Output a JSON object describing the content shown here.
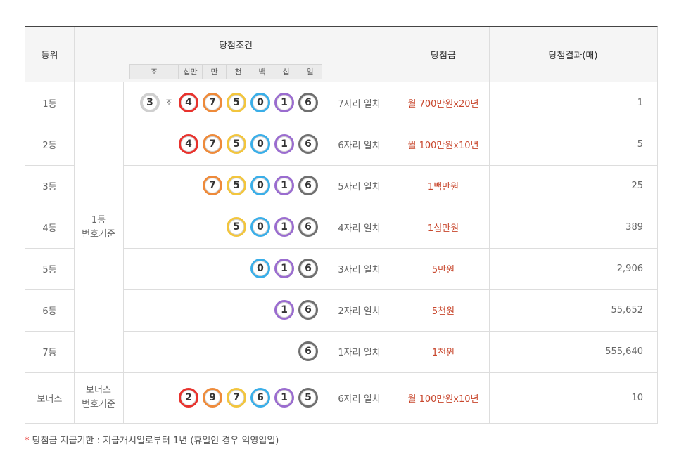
{
  "header": {
    "rank": "등위",
    "condition": "당첨조건",
    "prize": "당첨금",
    "result": "당첨결과(매)",
    "digits": [
      "조",
      "십만",
      "만",
      "천",
      "백",
      "십",
      "일"
    ]
  },
  "criteria": {
    "main": "1등\n번호기준",
    "bonus": "보너스\n번호기준"
  },
  "rows": [
    {
      "rank": "1등",
      "match": "7자리 일치",
      "prize": "월 700만원x20년",
      "count": "1"
    },
    {
      "rank": "2등",
      "match": "6자리 일치",
      "prize": "월 100만원x10년",
      "count": "5"
    },
    {
      "rank": "3등",
      "match": "5자리 일치",
      "prize": "1백만원",
      "count": "25"
    },
    {
      "rank": "4등",
      "match": "4자리 일치",
      "prize": "1십만원",
      "count": "389"
    },
    {
      "rank": "5등",
      "match": "3자리 일치",
      "prize": "5만원",
      "count": "2,906"
    },
    {
      "rank": "6등",
      "match": "2자리 일치",
      "prize": "5천원",
      "count": "55,652"
    },
    {
      "rank": "7등",
      "match": "1자리 일치",
      "prize": "1천원",
      "count": "555,640"
    },
    {
      "rank": "보너스",
      "match": "6자리 일치",
      "prize": "월 100만원x10년",
      "count": "10"
    }
  ],
  "jo_label": "조",
  "main_numbers": {
    "jo": "3",
    "digits": [
      "4",
      "7",
      "5",
      "0",
      "1",
      "6"
    ],
    "colors": [
      "red",
      "orange",
      "yellow",
      "blue",
      "purple",
      "gray"
    ]
  },
  "bonus_numbers": {
    "digits": [
      "2",
      "9",
      "7",
      "6",
      "1",
      "5"
    ],
    "colors": [
      "red",
      "orange",
      "yellow",
      "blue",
      "purple",
      "gray"
    ]
  },
  "colors": {
    "red": "#e8322d",
    "orange": "#ee8a3a",
    "yellow": "#f2c53d",
    "blue": "#3aaee8",
    "purple": "#9a6ccf",
    "gray": "#6f6f6f",
    "prize_text": "#c8472d"
  },
  "footnote": {
    "star": "*",
    "text": "당첨금 지급기한 : 지급개시일로부터 1년 (휴일인 경우 익영업일)"
  }
}
